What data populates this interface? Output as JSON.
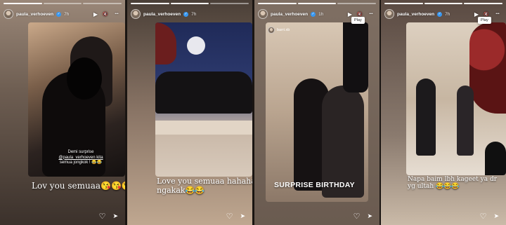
{
  "stories": [
    {
      "username": "paula_verhoeven",
      "time": "7h",
      "tooltip": "",
      "caption_small_1": "Demi surprise",
      "caption_small_2": "@paula_verhoeven kita",
      "caption_small_3": "semua jongkok ! 😂😂",
      "caption_big": "Lov you semuaa😘😘😘",
      "caption_big_2": ""
    },
    {
      "username": "paula_verhoeven",
      "time": "7h",
      "tooltip": "",
      "caption_small_1": "",
      "caption_small_2": "",
      "caption_small_3": "",
      "caption_big": "Love you semuaa hahaha",
      "caption_big_2": "ngakak😂😂"
    },
    {
      "username": "paula_verhoeven",
      "time": "1h",
      "tooltip": "Play",
      "repost_user": "barri.xb",
      "caption_small_1": "",
      "caption_small_2": "",
      "caption_small_3": "",
      "caption_big": "SURPRISE BIRTHDAY",
      "caption_big_2": ""
    },
    {
      "username": "paula_verhoeven",
      "time": "7h",
      "tooltip": "Play",
      "caption_small_1": "",
      "caption_small_2": "",
      "caption_small_3": "",
      "caption_big": "Napa baim lbh kageet ya dr",
      "caption_big_2": "yg ultah 😂😂😂"
    }
  ],
  "icons": {
    "play": "▶",
    "mute": "🔇",
    "more": "•••",
    "heart": "♡",
    "send": "➤"
  },
  "colors": {
    "accent_verified": "#3897f0",
    "background": "#1a1512"
  }
}
